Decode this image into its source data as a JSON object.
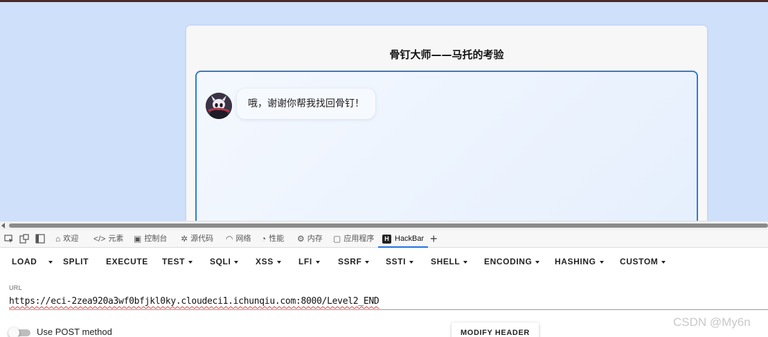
{
  "page": {
    "title": "骨钉大师——马托的考验",
    "chat_message": "哦，谢谢你帮我找回骨钉！"
  },
  "devtools": {
    "tabs": [
      {
        "label": "欢迎",
        "icon": "home-icon"
      },
      {
        "label": "元素",
        "icon": "code-icon"
      },
      {
        "label": "控制台",
        "icon": "console-icon"
      },
      {
        "label": "源代码",
        "icon": "bug-icon"
      },
      {
        "label": "网络",
        "icon": "wifi-icon"
      },
      {
        "label": "性能",
        "icon": "gauge-icon"
      },
      {
        "label": "内存",
        "icon": "memory-icon"
      },
      {
        "label": "应用程序",
        "icon": "app-icon"
      },
      {
        "label": "HackBar",
        "icon": "hackbar-logo-icon"
      }
    ],
    "active_tab": "HackBar"
  },
  "hackbar": {
    "menu": {
      "load": "LOAD",
      "split": "SPLIT",
      "execute": "EXECUTE",
      "test": "TEST",
      "sqli": "SQLI",
      "xss": "XSS",
      "lfi": "LFI",
      "ssrf": "SSRF",
      "ssti": "SSTI",
      "shell": "SHELL",
      "encoding": "ENCODING",
      "hashing": "HASHING",
      "custom": "CUSTOM"
    },
    "url_label": "URL",
    "url_value": "https://eci-2zea920a3wf0bfjkl0ky.cloudeci1.ichunqiu.com:8000/Level2_END",
    "post_toggle_label": "Use POST method",
    "post_enabled": false,
    "modify_header_label": "MODIFY HEADER"
  },
  "watermark": "CSDN @My6n",
  "colors": {
    "page_background": "#cfe0fb",
    "chatbox_border": "#2f7ad6",
    "active_tab_underline": "#1a73e8"
  }
}
